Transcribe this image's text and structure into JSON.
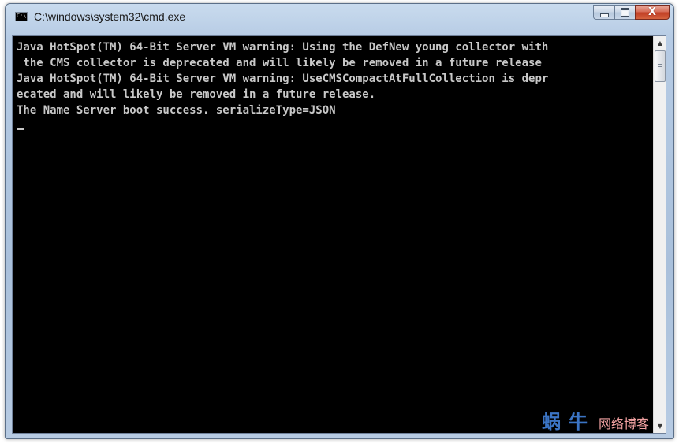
{
  "window": {
    "title": "C:\\windows\\system32\\cmd.exe",
    "icon": "cmd-console-icon",
    "icon_text": "C:\\.",
    "buttons": {
      "minimize": "minimize-icon",
      "maximize": "maximize-icon",
      "close": "close-icon",
      "close_glyph": "X"
    }
  },
  "console": {
    "lines": [
      "Java HotSpot(TM) 64-Bit Server VM warning: Using the DefNew young collector with",
      " the CMS collector is deprecated and will likely be removed in a future release",
      "Java HotSpot(TM) 64-Bit Server VM warning: UseCMSCompactAtFullCollection is depr",
      "ecated and will likely be removed in a future release.",
      "The Name Server boot success. serializeType=JSON"
    ],
    "foreground": "#c8c8c8",
    "background": "#000000"
  },
  "scrollbar": {
    "up_arrow": "▲",
    "down_arrow": "▼"
  },
  "watermark": {
    "brand": "蜗牛",
    "subtitle": "网络博客"
  }
}
